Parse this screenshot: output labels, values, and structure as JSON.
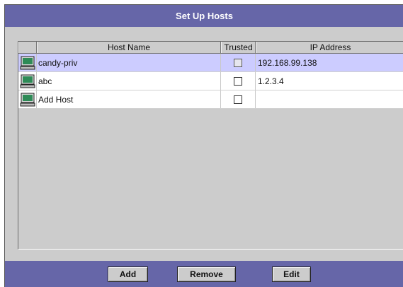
{
  "header": {
    "title": "Set Up Hosts"
  },
  "table": {
    "columns": [
      "Host Name",
      "Trusted",
      "IP Address"
    ],
    "rows": [
      {
        "icon": "computer-icon",
        "name": "candy-priv",
        "trusted": false,
        "ip": "192.168.99.138",
        "selected": true
      },
      {
        "icon": "computer-icon",
        "name": "abc",
        "trusted": false,
        "ip": "1.2.3.4",
        "selected": false
      },
      {
        "icon": "computer-icon",
        "name": "Add Host",
        "trusted": false,
        "ip": "",
        "selected": false
      }
    ]
  },
  "buttons": {
    "add": "Add",
    "remove": "Remove",
    "edit": "Edit"
  },
  "colors": {
    "bar": "#6666a8",
    "panel": "#cccccc",
    "selected_row": "#ccccff"
  }
}
